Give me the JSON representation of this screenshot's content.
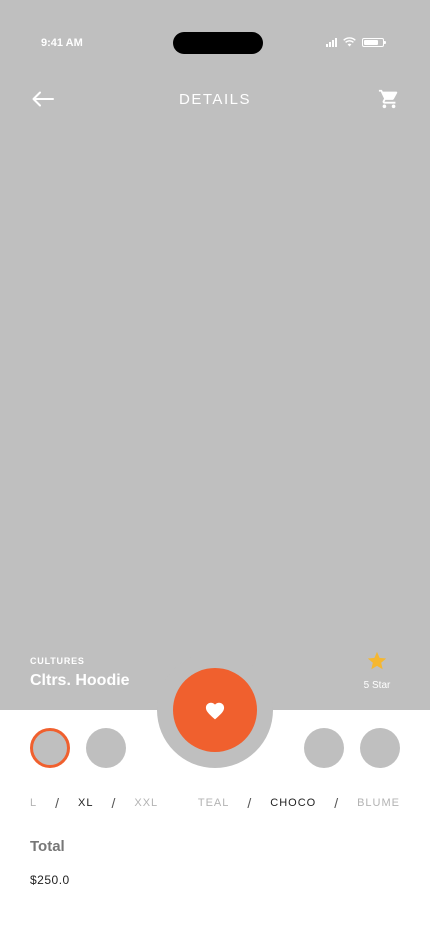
{
  "status_bar": {
    "time": "9:41 AM"
  },
  "nav": {
    "title": "DETAILS",
    "back_icon": "arrow-left-icon",
    "cart_icon": "shopping-cart-icon"
  },
  "product": {
    "brand": "CULTURES",
    "name": "Cltrs. Hoodie",
    "rating_label": "5 Star",
    "rating_icon": "star-icon"
  },
  "sizes": {
    "options": [
      "L",
      "XL",
      "XXL"
    ],
    "selected": "XL"
  },
  "colors": {
    "options": [
      "TEAL",
      "CHOCO",
      "BLUME"
    ],
    "selected": "CHOCO"
  },
  "total": {
    "label": "Total",
    "value": "$250.0"
  },
  "theme": {
    "accent": "#f0602e",
    "placeholder": "#bfbfbf",
    "star": "#f5b731"
  }
}
